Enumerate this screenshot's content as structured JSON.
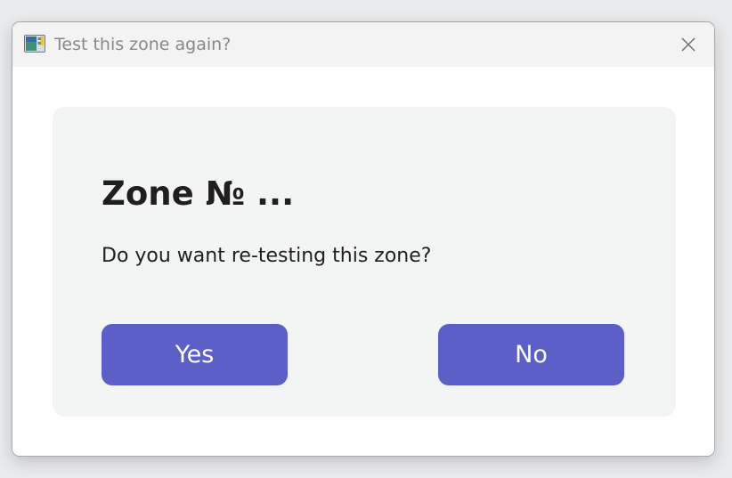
{
  "window": {
    "title": "Test this zone again?",
    "app_icon": "app-window-icon",
    "close_icon": "close-icon"
  },
  "dialog": {
    "heading": "Zone № ...",
    "message": "Do you want re-testing this zone?",
    "yes_label": "Yes",
    "no_label": "No"
  },
  "colors": {
    "accent": "#5b5fc7",
    "card_background": "#f3f4f4",
    "titlebar_background": "#f3f3f3",
    "text": "#1f1f1f",
    "title_text": "#888888"
  }
}
